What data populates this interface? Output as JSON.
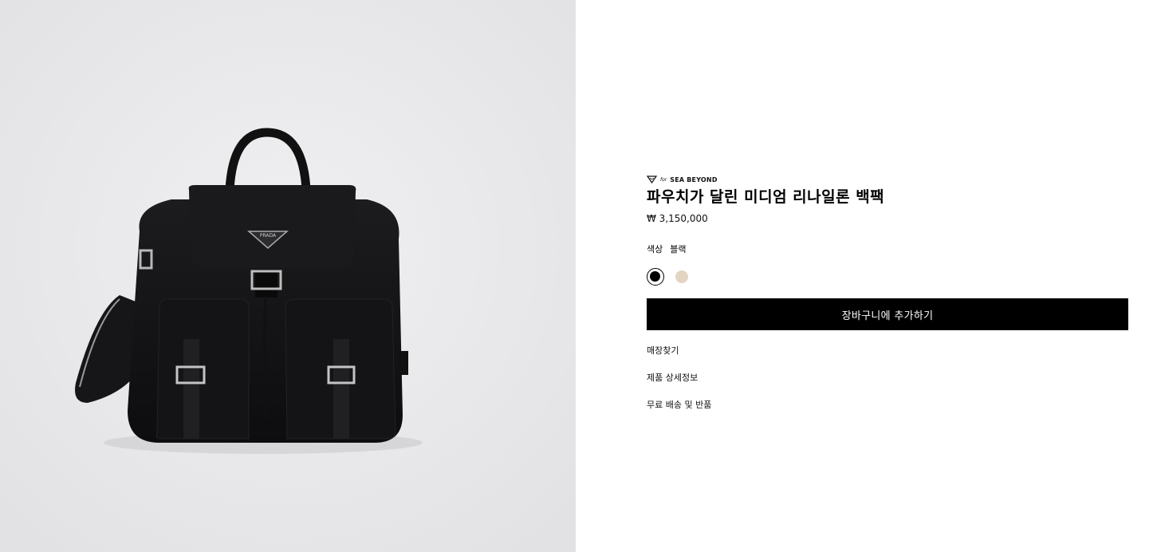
{
  "product_image": {
    "alt": "",
    "logo_text": "PRADA"
  },
  "badge": {
    "icon": "diamond-heart-icon",
    "for_text": "for",
    "brand_text": "SEA BEYOND"
  },
  "product": {
    "title": "파우치가 달린 미디엄 리나일론 백팩",
    "price": "₩ 3,150,000"
  },
  "color": {
    "label": "색상",
    "selected": "블랙",
    "swatches": [
      {
        "name": "블랙",
        "hex": "#000000"
      },
      {
        "name": "베이지",
        "hex": "#e2d6c2"
      }
    ]
  },
  "actions": {
    "add_to_cart": "장바구니에 추가하기"
  },
  "links": {
    "find_store": "매장찾기",
    "product_details": "제품 상세정보",
    "free_shipping": "무료 배송 및 반품"
  }
}
